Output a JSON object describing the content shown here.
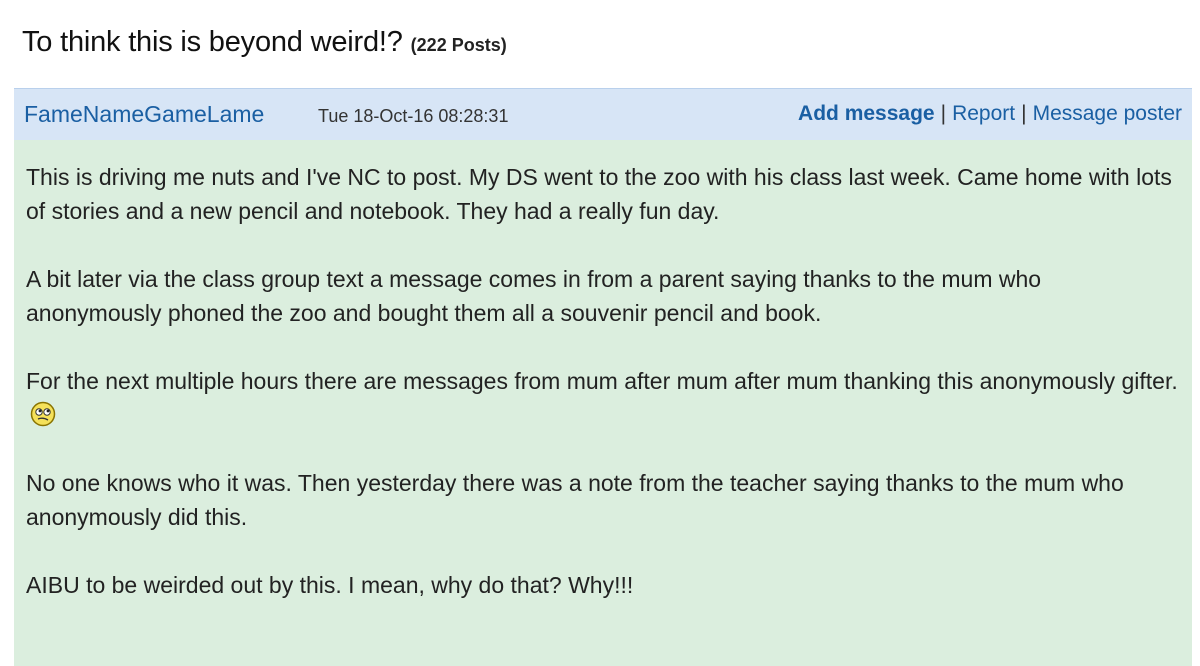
{
  "thread": {
    "title": "To think this is beyond weird!?",
    "post_count": "(222 Posts)"
  },
  "post": {
    "poster_name": "FameNameGameLame",
    "date": "Tue 18-Oct-16 08:28:31",
    "actions": {
      "add_message": "Add message",
      "separator": "|",
      "report": "Report",
      "message_poster": "Message poster"
    },
    "paragraphs": [
      "This is driving me nuts and I've NC to post. My DS went to the zoo with his class last week. Came home with lots of stories and a new pencil and notebook. They had a really fun day.",
      "A bit later via the class group text a message comes in from a parent saying thanks to the mum who anonymously phoned the zoo and bought them all a souvenir pencil and book.",
      "For the next multiple hours there are messages from mum after mum after mum thanking this anonymously gifter.",
      "No one knows who it was. Then yesterday there was a note from the teacher saying thanks to the mum who anonymously did this.",
      "AIBU to be weirded out by this. I mean, why do that? Why!!!"
    ],
    "emoji": "confused-face-icon"
  },
  "colors": {
    "header_bg": "#d7e5f6",
    "body_bg": "#dbeede",
    "link": "#1a5fa3"
  }
}
